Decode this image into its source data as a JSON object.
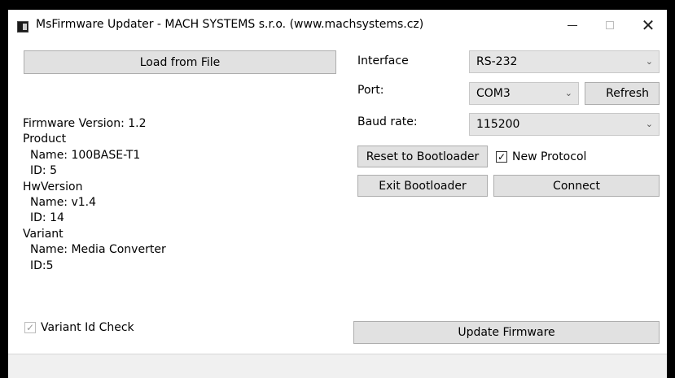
{
  "window": {
    "title": "MsFirmware Updater - MACH SYSTEMS s.r.o. (www.machsystems.cz)",
    "close_glyph": "✕"
  },
  "left": {
    "load_button": "Load from File",
    "firmware_version": "Firmware Version: 1.2",
    "product_header": "Product",
    "product_name": "Name: 100BASE-T1",
    "product_id": "ID: 5",
    "hw_header": "HwVersion",
    "hw_name": "Name: v1.4",
    "hw_id": "ID: 14",
    "variant_header": "Variant",
    "variant_name": "Name: Media Converter",
    "variant_id": "ID:5",
    "variant_check_label": "Variant Id Check",
    "variant_check_checked": true
  },
  "right": {
    "interface_label": "Interface",
    "interface_value": "RS-232",
    "port_label": "Port:",
    "port_value": "COM3",
    "refresh_button": "Refresh",
    "baud_label": "Baud rate:",
    "baud_value": "115200",
    "reset_button": "Reset to Bootloader",
    "new_protocol_label": "New Protocol",
    "new_protocol_checked": true,
    "exit_button": "Exit Bootloader",
    "connect_button": "Connect",
    "update_button": "Update Firmware"
  },
  "icons": {
    "chevron": "⌄",
    "check": "✓"
  }
}
